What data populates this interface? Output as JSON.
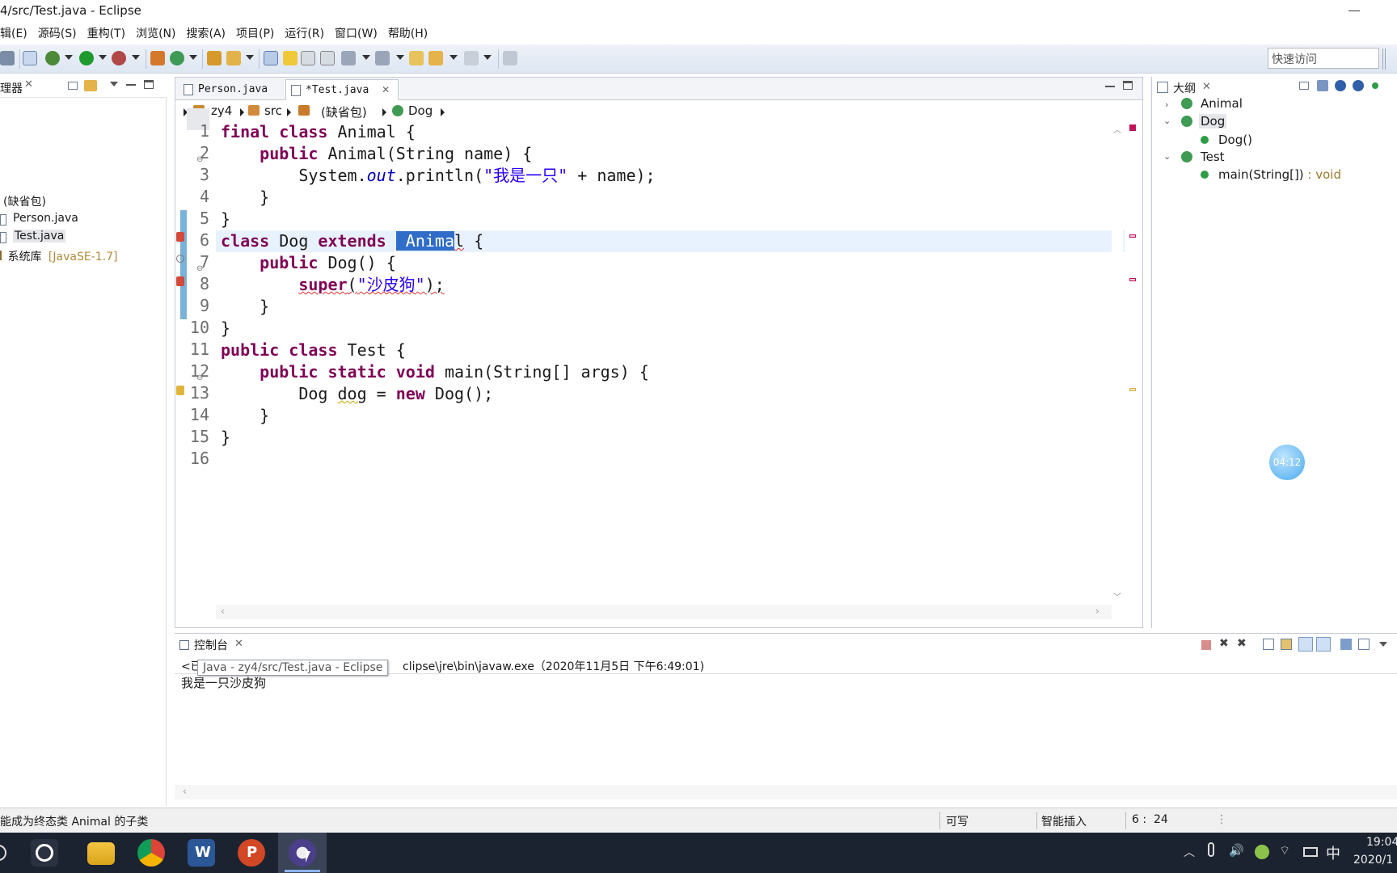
{
  "window": {
    "title": "4/src/Test.java  -  Eclipse"
  },
  "menu": [
    "辑(E)",
    "源码(S)",
    "重构(T)",
    "浏览(N)",
    "搜索(A)",
    "项目(P)",
    "运行(R)",
    "窗口(W)",
    "帮助(H)"
  ],
  "toolbar": {
    "quick_access_placeholder": "快速访问"
  },
  "package_explorer": {
    "title": "理器",
    "items": [
      {
        "label": "(缺省包)",
        "detail": ""
      },
      {
        "label": "Person.java",
        "detail": ""
      },
      {
        "label": "Test.java",
        "detail": ""
      },
      {
        "label": "系统库",
        "detail": "[JavaSE-1.7]"
      }
    ]
  },
  "editor": {
    "tabs": [
      {
        "label": "Person.java",
        "active": false
      },
      {
        "label": "*Test.java",
        "active": true
      }
    ],
    "breadcrumb": [
      "zy4",
      "src",
      "(缺省包)",
      "Dog"
    ],
    "line_numbers": [
      "1",
      "2",
      "3",
      "4",
      "5",
      "6",
      "7",
      "8",
      "9",
      "10",
      "11",
      "12",
      "13",
      "14",
      "15",
      "16"
    ],
    "current_line": 6,
    "code_lines": [
      [
        {
          "t": "final class ",
          "c": "kw"
        },
        {
          "t": "Animal {",
          "c": ""
        }
      ],
      [
        {
          "t": "    ",
          "c": ""
        },
        {
          "t": "public ",
          "c": "kw"
        },
        {
          "t": "Animal(String name) {",
          "c": ""
        }
      ],
      [
        {
          "t": "        System.",
          "c": ""
        },
        {
          "t": "out",
          "c": "it"
        },
        {
          "t": ".println(",
          "c": ""
        },
        {
          "t": "\"我是一只\"",
          "c": "st"
        },
        {
          "t": " + name);",
          "c": ""
        }
      ],
      [
        {
          "t": "    }",
          "c": ""
        }
      ],
      [
        {
          "t": "}",
          "c": ""
        }
      ],
      [
        {
          "t": "class ",
          "c": "kw"
        },
        {
          "t": "Dog ",
          "c": ""
        },
        {
          "t": "extends ",
          "c": "kw"
        },
        {
          "t": " Anima",
          "c": "sel"
        },
        {
          "t": "l",
          "c": "squig"
        },
        {
          "t": " {",
          "c": ""
        }
      ],
      [
        {
          "t": "    ",
          "c": ""
        },
        {
          "t": "public ",
          "c": "kw"
        },
        {
          "t": "Dog() {",
          "c": ""
        }
      ],
      [
        {
          "t": "        ",
          "c": ""
        },
        {
          "t": "super",
          "c": "kw squig"
        },
        {
          "t": "(",
          "c": "squig"
        },
        {
          "t": "\"沙皮狗\"",
          "c": "st squig"
        },
        {
          "t": ");",
          "c": "squig"
        }
      ],
      [
        {
          "t": "    }",
          "c": ""
        }
      ],
      [
        {
          "t": "}",
          "c": ""
        }
      ],
      [
        {
          "t": "public class ",
          "c": "kw"
        },
        {
          "t": "Test {",
          "c": ""
        }
      ],
      [
        {
          "t": "    ",
          "c": ""
        },
        {
          "t": "public static void ",
          "c": "kw"
        },
        {
          "t": "main(String[] args) {",
          "c": ""
        }
      ],
      [
        {
          "t": "        Dog ",
          "c": ""
        },
        {
          "t": "dog",
          "c": "squigy"
        },
        {
          "t": " = ",
          "c": ""
        },
        {
          "t": "new ",
          "c": "kw"
        },
        {
          "t": "Dog();",
          "c": ""
        }
      ],
      [
        {
          "t": "    }",
          "c": ""
        }
      ],
      [
        {
          "t": "}",
          "c": ""
        }
      ],
      [
        {
          "t": "",
          "c": ""
        }
      ]
    ]
  },
  "outline": {
    "title": "大纲",
    "items": [
      {
        "label": "Animal",
        "detail": ""
      },
      {
        "label": "Dog",
        "detail": ""
      },
      {
        "label": "Dog()",
        "detail": ""
      },
      {
        "label": "Test",
        "detail": ""
      },
      {
        "label": "main(String[])",
        "detail": " : void"
      }
    ]
  },
  "recording_badge": "04:12",
  "console": {
    "title": "控制台",
    "header_prefix": "<已",
    "header_suffix": "clipse\\jre\\bin\\javaw.exe（2020年11月5日 下午6:49:01)",
    "output": "我是一只沙皮狗",
    "tooltip": "Java  -  zy4/src/Test.java  -  Eclipse"
  },
  "status": {
    "message": "能成为终态类 Animal 的子类",
    "writable": "可写",
    "insert_mode": "智能插入",
    "position": "6 :  24"
  },
  "taskbar": {
    "ime": "中",
    "time": "19:04",
    "date": "2020/1"
  }
}
